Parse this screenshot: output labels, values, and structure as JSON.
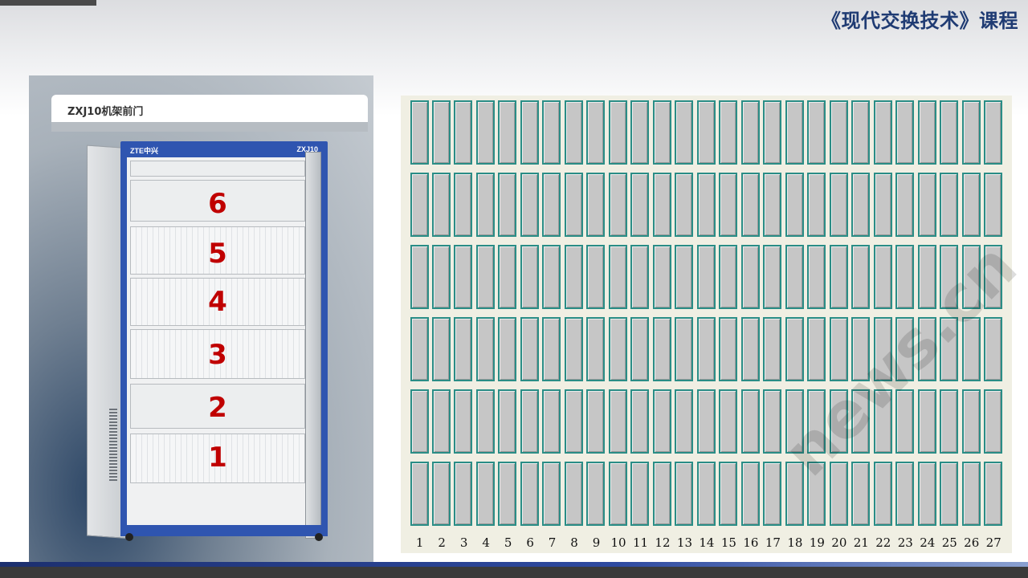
{
  "header": {
    "course_title": "《现代交换技术》课程"
  },
  "photo": {
    "header_label": "ZXJ10机架前门",
    "brand_left": "ZTE中兴",
    "brand_right": "ZXJ10",
    "shelves": [
      {
        "number": "6",
        "type": "blank"
      },
      {
        "number": "5",
        "type": "cards"
      },
      {
        "number": "4",
        "type": "cards"
      },
      {
        "number": "3",
        "type": "cards"
      },
      {
        "number": "2",
        "type": "blank"
      },
      {
        "number": "1",
        "type": "cards"
      }
    ]
  },
  "rack": {
    "rows": 6,
    "slot_labels": [
      "1",
      "2",
      "3",
      "4",
      "5",
      "6",
      "7",
      "8",
      "9",
      "10",
      "11",
      "12",
      "13",
      "14",
      "15",
      "16",
      "17",
      "18",
      "19",
      "20",
      "21",
      "22",
      "23",
      "24",
      "25",
      "26",
      "27"
    ],
    "colors": {
      "slot_fill": "#c6c6c6",
      "slot_border": "#2a8d86",
      "background": "#f0efe3"
    }
  },
  "colors": {
    "shelf_number": "#c00000",
    "title": "#1f3b73",
    "cabinet_blue": "#2f55b0"
  }
}
